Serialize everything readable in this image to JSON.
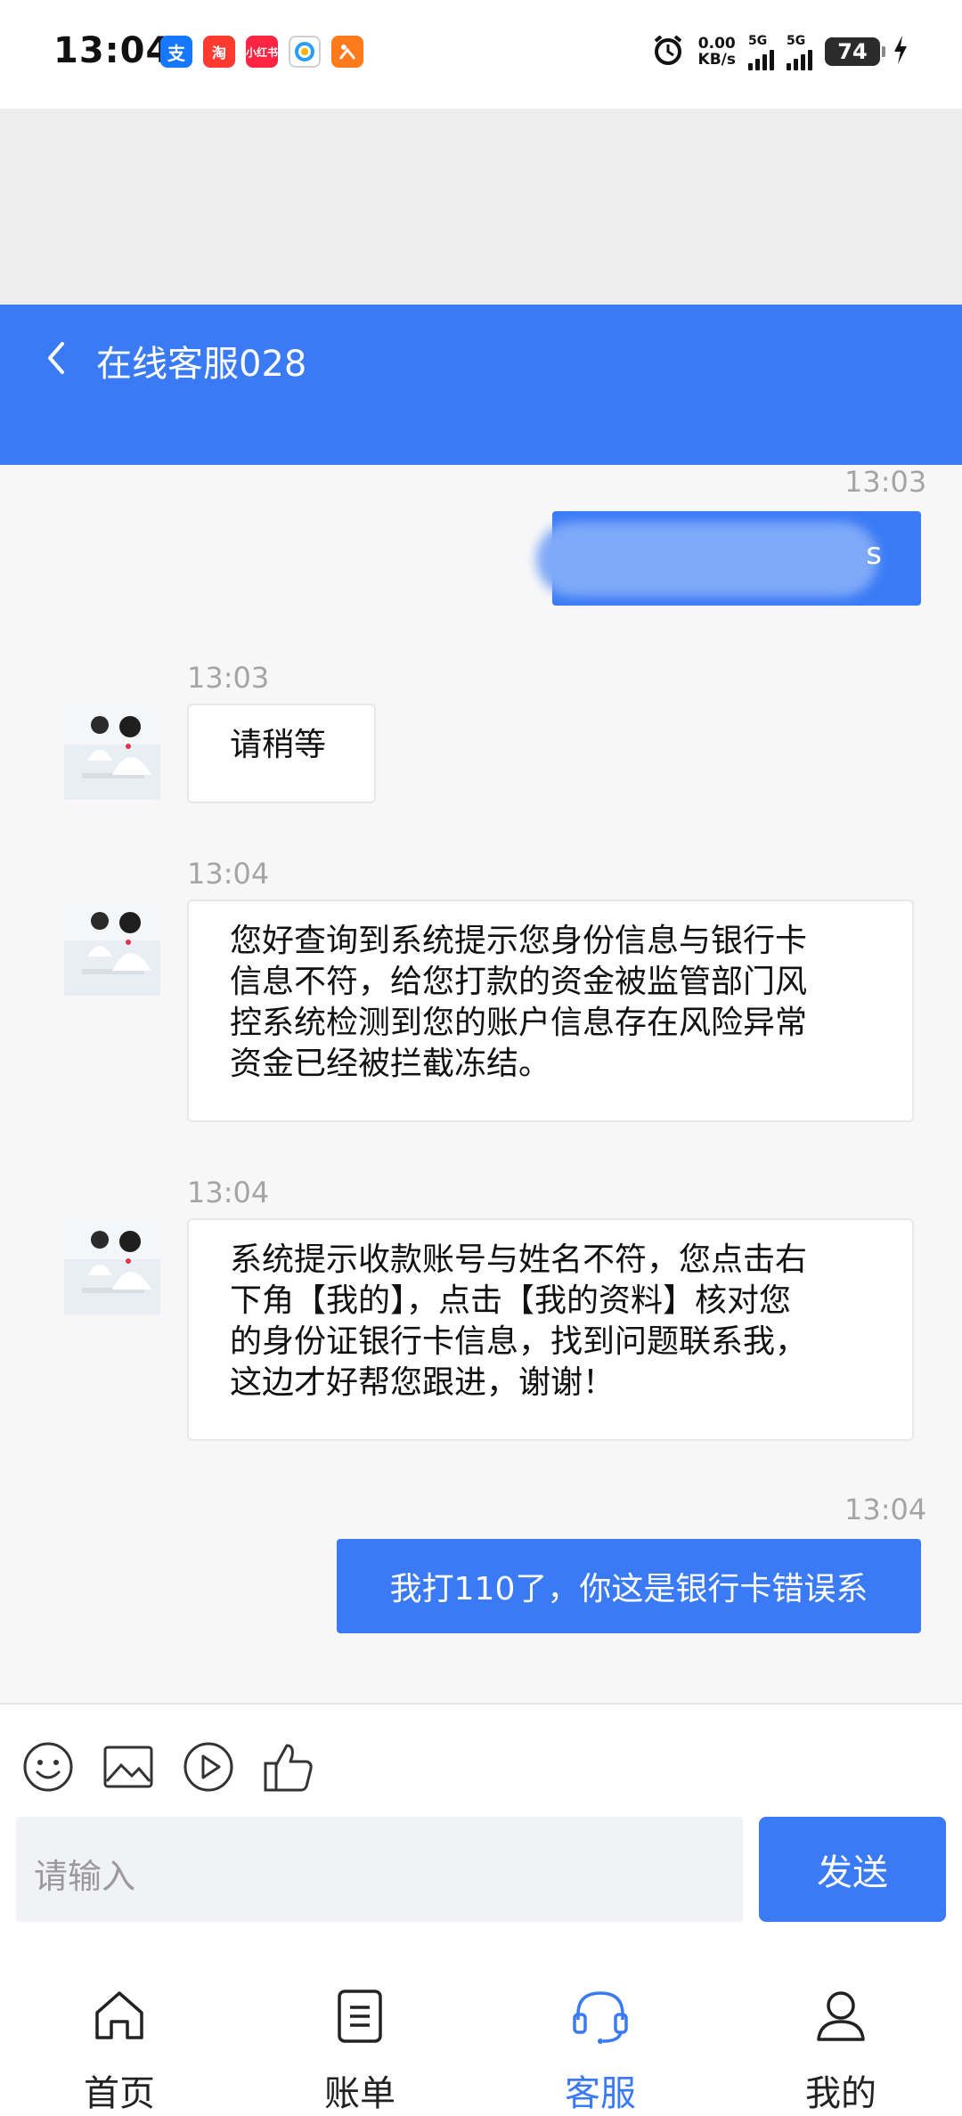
{
  "status_bar": {
    "time": "13:04",
    "apps": [
      {
        "icon": "alipay-icon",
        "text": "支",
        "color": "#1677ff"
      },
      {
        "icon": "shopping-app-icon",
        "text": "淘",
        "color": "#ff3b30"
      },
      {
        "icon": "xiaohongshu-icon",
        "text": "小红书",
        "color": "#ff2442"
      },
      {
        "icon": "circle-app-icon",
        "text": "",
        "color": "#ffffff"
      },
      {
        "icon": "orange-app-icon",
        "text": "",
        "color": "#ff7a1a"
      }
    ],
    "net_speed_value": "0.00",
    "net_speed_unit": "KB/s",
    "sig1": "5G",
    "sig2": "5G",
    "battery": "74"
  },
  "header": {
    "title": "在线客服028"
  },
  "messages": [
    {
      "time": "13:03",
      "side": "out",
      "text": ""
    },
    {
      "time": "13:03",
      "side": "in",
      "text": "请稍等"
    },
    {
      "time": "13:04",
      "side": "in",
      "lines": [
        "您好查询到系统提示您身份信息与银行卡",
        "信息不符，给您打款的资金被监管部门风",
        "控系统检测到您的账户信息存在风险异常",
        "资金已经被拦截冻结。"
      ]
    },
    {
      "time": "13:04",
      "side": "in",
      "lines": [
        "系统提示收款账号与姓名不符，您点击右",
        "下角【我的】，点击【我的资料】核对您",
        "的身份证银行卡信息，找到问题联系我，",
        "这边才好帮您跟进，谢谢！"
      ]
    },
    {
      "time": "13:04",
      "side": "out",
      "text": "我打110了，你这是银行卡错误系"
    }
  ],
  "input": {
    "placeholder": "请输入",
    "send_label": "发送"
  },
  "tools": [
    "emoji-icon",
    "image-icon",
    "video-icon",
    "thumbs-up-icon"
  ],
  "nav": {
    "items": [
      {
        "label": "首页",
        "icon": "home-icon"
      },
      {
        "label": "账单",
        "icon": "bill-icon"
      },
      {
        "label": "客服",
        "icon": "headset-icon",
        "active": true
      },
      {
        "label": "我的",
        "icon": "user-icon"
      }
    ],
    "accent": "#3a7bf5"
  },
  "colors": {
    "primary": "#3a7bf5",
    "chat_bg": "#f7f7f8"
  }
}
